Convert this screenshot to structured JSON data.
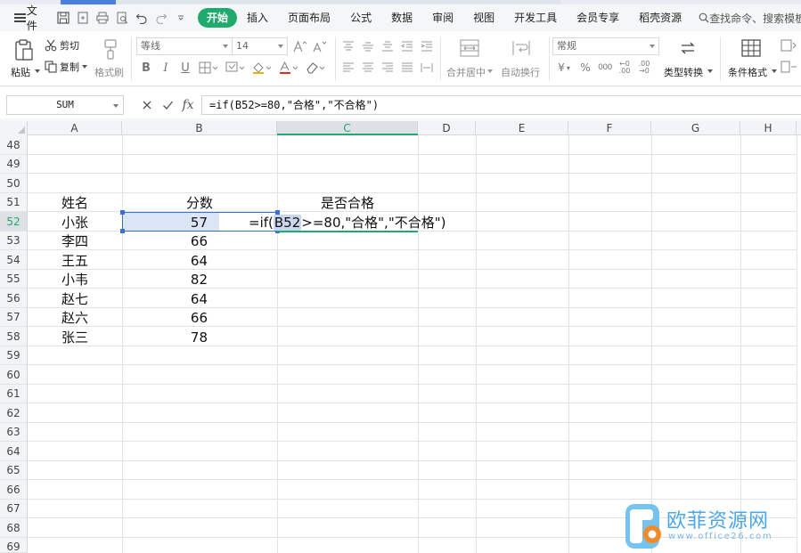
{
  "menubar": {
    "file_label": "文件",
    "tabs": [
      "开始",
      "插入",
      "页面布局",
      "公式",
      "数据",
      "审阅",
      "视图",
      "开发工具",
      "会员专享",
      "稻壳资源"
    ],
    "active_tab": "开始",
    "search_label": "查找命令、搜索模板"
  },
  "ribbon": {
    "paste_label": "粘贴",
    "cut_label": "剪切",
    "copy_label": "复制",
    "format_painter_label": "格式刷",
    "font_family": "等线",
    "font_size": "14",
    "merge_label": "合并居中",
    "wrap_label": "自动换行",
    "number_format": "常规",
    "convert_label": "类型转换",
    "cond_format_label": "条件格式"
  },
  "formula_bar": {
    "name_box": "SUM",
    "fx_label": "fx",
    "formula": "=if(B52>=80,\"合格\",\"不合格\")"
  },
  "sheet": {
    "columns": [
      "A",
      "B",
      "C",
      "D",
      "E",
      "F",
      "G",
      "H"
    ],
    "active_column": "C",
    "rows": [
      "48",
      "49",
      "50",
      "51",
      "52",
      "53",
      "54",
      "55",
      "56",
      "57",
      "58",
      "59",
      "60",
      "61",
      "62",
      "63",
      "64",
      "65",
      "66",
      "67",
      "68",
      "69"
    ],
    "active_row": "52",
    "headers": {
      "name": "姓名",
      "score": "分数",
      "pass": "是否合格"
    },
    "records": [
      {
        "name": "小张",
        "score": "57"
      },
      {
        "name": "李四",
        "score": "66"
      },
      {
        "name": "王五",
        "score": "64"
      },
      {
        "name": "小韦",
        "score": "82"
      },
      {
        "name": "赵七",
        "score": "64"
      },
      {
        "name": "赵六",
        "score": "66"
      },
      {
        "name": "张三",
        "score": "78"
      }
    ],
    "editing": {
      "prefix": "=if(",
      "ref": "B52",
      "suffix": ">=80,\"合格\",\"不合格\")"
    }
  },
  "watermark": {
    "title": "欧菲资源网",
    "url": "www.office26.com"
  },
  "colors": {
    "accent": "#1eab6b",
    "selection_blue": "#3a6fd8"
  }
}
